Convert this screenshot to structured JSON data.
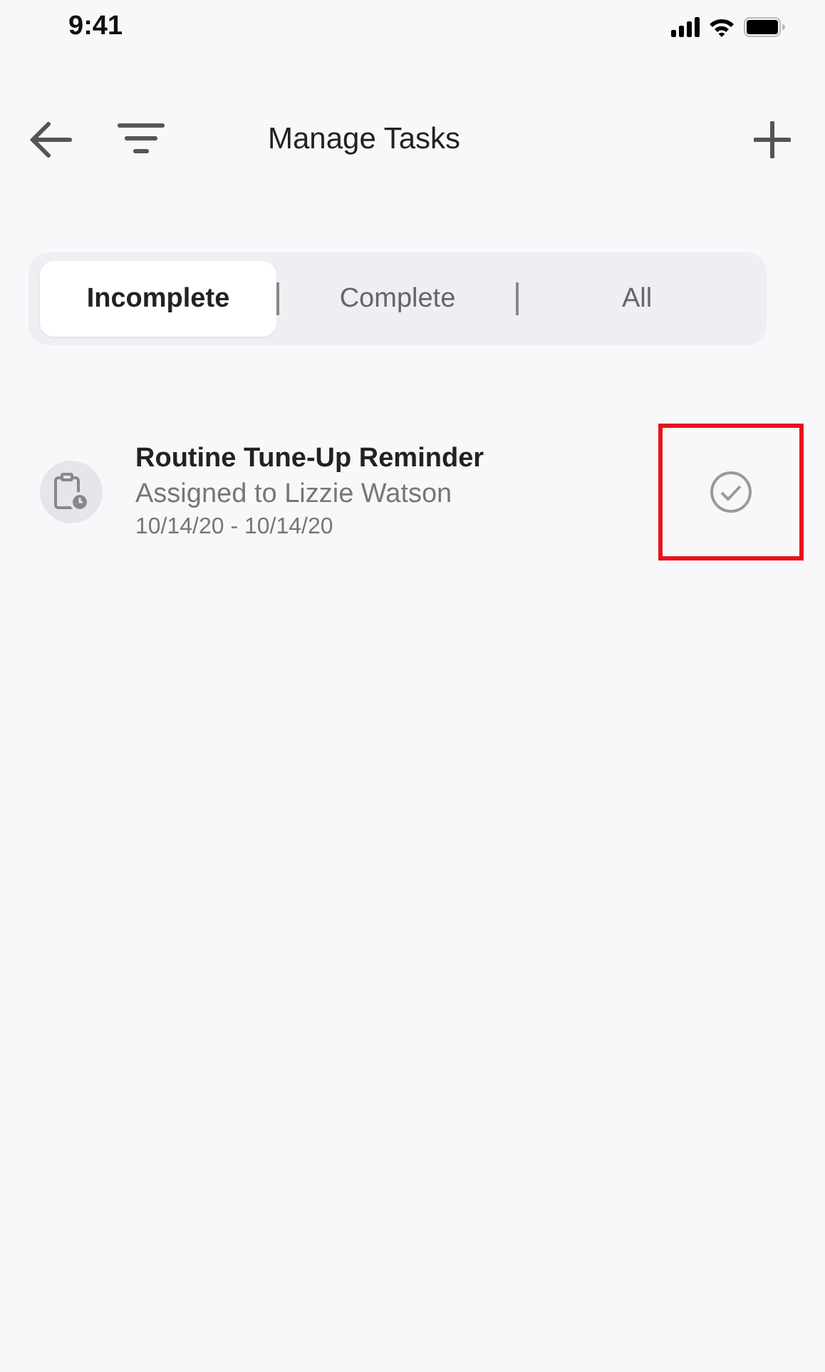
{
  "status_bar": {
    "time": "9:41"
  },
  "nav": {
    "title": "Manage Tasks"
  },
  "segments": [
    {
      "label": "Incomplete",
      "selected": true
    },
    {
      "label": "Complete",
      "selected": false
    },
    {
      "label": "All",
      "selected": false
    }
  ],
  "tasks": [
    {
      "title": "Routine Tune-Up Reminder",
      "assignee": "Assigned to Lizzie Watson",
      "dates": "10/14/20 - 10/14/20",
      "completed": false,
      "highlighted": true
    }
  ]
}
